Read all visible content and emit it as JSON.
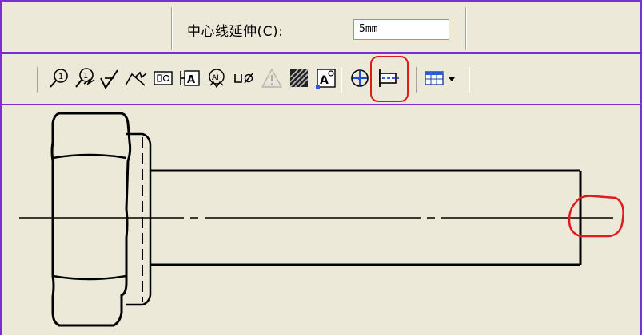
{
  "property_bar": {
    "centerline_extension_label_prefix": "中心线延伸(",
    "centerline_extension_hotkey": "C",
    "centerline_extension_label_suffix": "):",
    "centerline_extension_value": "5mm"
  },
  "toolbar": {
    "icons": [
      "balloon-icon",
      "multi-balloon-icon",
      "surface-finish-icon",
      "weld-symbol-icon",
      "datum-feature-icon",
      "datum-target-icon",
      "feature-control-frame-icon",
      "hole-callout-icon",
      "warning-triangle-icon",
      "hatch-icon",
      "block-text-icon",
      "center-mark-icon",
      "centerline-icon",
      "table-icon"
    ]
  },
  "colors": {
    "window_border": "#7b2fd0",
    "highlight": "#e01b1b",
    "background": "#ece9d8"
  }
}
